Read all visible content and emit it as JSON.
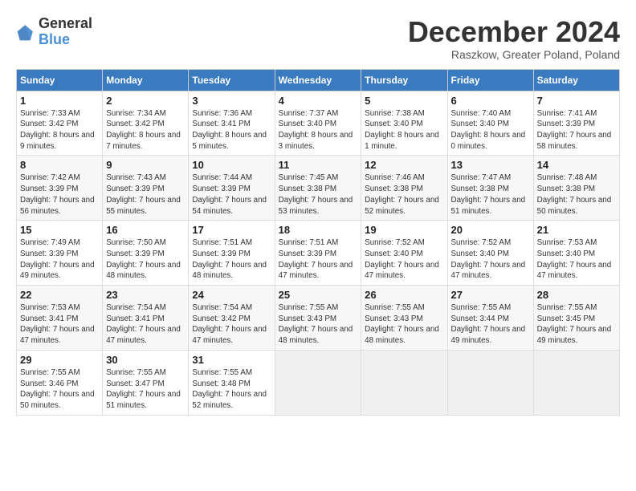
{
  "header": {
    "logo_general": "General",
    "logo_blue": "Blue",
    "title": "December 2024",
    "subtitle": "Raszkow, Greater Poland, Poland"
  },
  "columns": [
    "Sunday",
    "Monday",
    "Tuesday",
    "Wednesday",
    "Thursday",
    "Friday",
    "Saturday"
  ],
  "weeks": [
    [
      {
        "day": "1",
        "sunrise": "Sunrise: 7:33 AM",
        "sunset": "Sunset: 3:42 PM",
        "daylight": "Daylight: 8 hours and 9 minutes."
      },
      {
        "day": "2",
        "sunrise": "Sunrise: 7:34 AM",
        "sunset": "Sunset: 3:42 PM",
        "daylight": "Daylight: 8 hours and 7 minutes."
      },
      {
        "day": "3",
        "sunrise": "Sunrise: 7:36 AM",
        "sunset": "Sunset: 3:41 PM",
        "daylight": "Daylight: 8 hours and 5 minutes."
      },
      {
        "day": "4",
        "sunrise": "Sunrise: 7:37 AM",
        "sunset": "Sunset: 3:40 PM",
        "daylight": "Daylight: 8 hours and 3 minutes."
      },
      {
        "day": "5",
        "sunrise": "Sunrise: 7:38 AM",
        "sunset": "Sunset: 3:40 PM",
        "daylight": "Daylight: 8 hours and 1 minute."
      },
      {
        "day": "6",
        "sunrise": "Sunrise: 7:40 AM",
        "sunset": "Sunset: 3:40 PM",
        "daylight": "Daylight: 8 hours and 0 minutes."
      },
      {
        "day": "7",
        "sunrise": "Sunrise: 7:41 AM",
        "sunset": "Sunset: 3:39 PM",
        "daylight": "Daylight: 7 hours and 58 minutes."
      }
    ],
    [
      {
        "day": "8",
        "sunrise": "Sunrise: 7:42 AM",
        "sunset": "Sunset: 3:39 PM",
        "daylight": "Daylight: 7 hours and 56 minutes."
      },
      {
        "day": "9",
        "sunrise": "Sunrise: 7:43 AM",
        "sunset": "Sunset: 3:39 PM",
        "daylight": "Daylight: 7 hours and 55 minutes."
      },
      {
        "day": "10",
        "sunrise": "Sunrise: 7:44 AM",
        "sunset": "Sunset: 3:39 PM",
        "daylight": "Daylight: 7 hours and 54 minutes."
      },
      {
        "day": "11",
        "sunrise": "Sunrise: 7:45 AM",
        "sunset": "Sunset: 3:38 PM",
        "daylight": "Daylight: 7 hours and 53 minutes."
      },
      {
        "day": "12",
        "sunrise": "Sunrise: 7:46 AM",
        "sunset": "Sunset: 3:38 PM",
        "daylight": "Daylight: 7 hours and 52 minutes."
      },
      {
        "day": "13",
        "sunrise": "Sunrise: 7:47 AM",
        "sunset": "Sunset: 3:38 PM",
        "daylight": "Daylight: 7 hours and 51 minutes."
      },
      {
        "day": "14",
        "sunrise": "Sunrise: 7:48 AM",
        "sunset": "Sunset: 3:38 PM",
        "daylight": "Daylight: 7 hours and 50 minutes."
      }
    ],
    [
      {
        "day": "15",
        "sunrise": "Sunrise: 7:49 AM",
        "sunset": "Sunset: 3:39 PM",
        "daylight": "Daylight: 7 hours and 49 minutes."
      },
      {
        "day": "16",
        "sunrise": "Sunrise: 7:50 AM",
        "sunset": "Sunset: 3:39 PM",
        "daylight": "Daylight: 7 hours and 48 minutes."
      },
      {
        "day": "17",
        "sunrise": "Sunrise: 7:51 AM",
        "sunset": "Sunset: 3:39 PM",
        "daylight": "Daylight: 7 hours and 48 minutes."
      },
      {
        "day": "18",
        "sunrise": "Sunrise: 7:51 AM",
        "sunset": "Sunset: 3:39 PM",
        "daylight": "Daylight: 7 hours and 47 minutes."
      },
      {
        "day": "19",
        "sunrise": "Sunrise: 7:52 AM",
        "sunset": "Sunset: 3:40 PM",
        "daylight": "Daylight: 7 hours and 47 minutes."
      },
      {
        "day": "20",
        "sunrise": "Sunrise: 7:52 AM",
        "sunset": "Sunset: 3:40 PM",
        "daylight": "Daylight: 7 hours and 47 minutes."
      },
      {
        "day": "21",
        "sunrise": "Sunrise: 7:53 AM",
        "sunset": "Sunset: 3:40 PM",
        "daylight": "Daylight: 7 hours and 47 minutes."
      }
    ],
    [
      {
        "day": "22",
        "sunrise": "Sunrise: 7:53 AM",
        "sunset": "Sunset: 3:41 PM",
        "daylight": "Daylight: 7 hours and 47 minutes."
      },
      {
        "day": "23",
        "sunrise": "Sunrise: 7:54 AM",
        "sunset": "Sunset: 3:41 PM",
        "daylight": "Daylight: 7 hours and 47 minutes."
      },
      {
        "day": "24",
        "sunrise": "Sunrise: 7:54 AM",
        "sunset": "Sunset: 3:42 PM",
        "daylight": "Daylight: 7 hours and 47 minutes."
      },
      {
        "day": "25",
        "sunrise": "Sunrise: 7:55 AM",
        "sunset": "Sunset: 3:43 PM",
        "daylight": "Daylight: 7 hours and 48 minutes."
      },
      {
        "day": "26",
        "sunrise": "Sunrise: 7:55 AM",
        "sunset": "Sunset: 3:43 PM",
        "daylight": "Daylight: 7 hours and 48 minutes."
      },
      {
        "day": "27",
        "sunrise": "Sunrise: 7:55 AM",
        "sunset": "Sunset: 3:44 PM",
        "daylight": "Daylight: 7 hours and 49 minutes."
      },
      {
        "day": "28",
        "sunrise": "Sunrise: 7:55 AM",
        "sunset": "Sunset: 3:45 PM",
        "daylight": "Daylight: 7 hours and 49 minutes."
      }
    ],
    [
      {
        "day": "29",
        "sunrise": "Sunrise: 7:55 AM",
        "sunset": "Sunset: 3:46 PM",
        "daylight": "Daylight: 7 hours and 50 minutes."
      },
      {
        "day": "30",
        "sunrise": "Sunrise: 7:55 AM",
        "sunset": "Sunset: 3:47 PM",
        "daylight": "Daylight: 7 hours and 51 minutes."
      },
      {
        "day": "31",
        "sunrise": "Sunrise: 7:55 AM",
        "sunset": "Sunset: 3:48 PM",
        "daylight": "Daylight: 7 hours and 52 minutes."
      },
      null,
      null,
      null,
      null
    ]
  ]
}
